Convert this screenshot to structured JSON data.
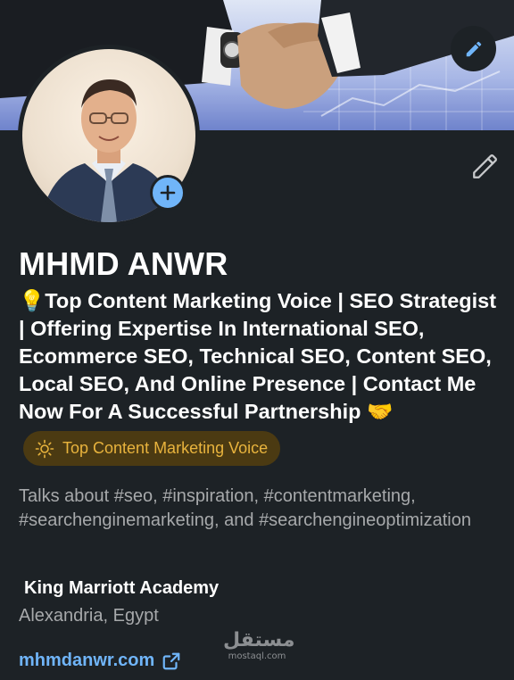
{
  "profile": {
    "name": "MHMD ANWR",
    "headline_emoji": "💡",
    "headline": "Top Content Marketing Voice | SEO Strategist | Offering Expertise In International SEO, Ecommerce SEO, Technical SEO, Content SEO, Local SEO, And Online Presence | Contact Me Now For A Successful Partnership",
    "headline_end_emoji": "🤝",
    "badge_label": "Top Content Marketing Voice",
    "talks_about": "Talks about #seo, #inspiration, #contentmarketing, #searchenginemarketing, and #searchengineoptimization",
    "company": "King Marriott Academy",
    "location": "Alexandria, Egypt",
    "website": "mhmdanwr.com"
  },
  "watermark": {
    "arabic": "مستقل",
    "latin": "mostaql.com"
  },
  "icons": {
    "banner_edit": "pencil-icon",
    "profile_edit": "pencil-icon",
    "add_photo": "plus-icon",
    "badge": "lightbulb-rays-icon",
    "website": "external-link-icon"
  },
  "colors": {
    "background": "#1d2226",
    "link": "#70b5f9",
    "badge_bg": "#4b3a12",
    "badge_text": "#e8b33d",
    "secondary_text": "#a7a9ab"
  }
}
